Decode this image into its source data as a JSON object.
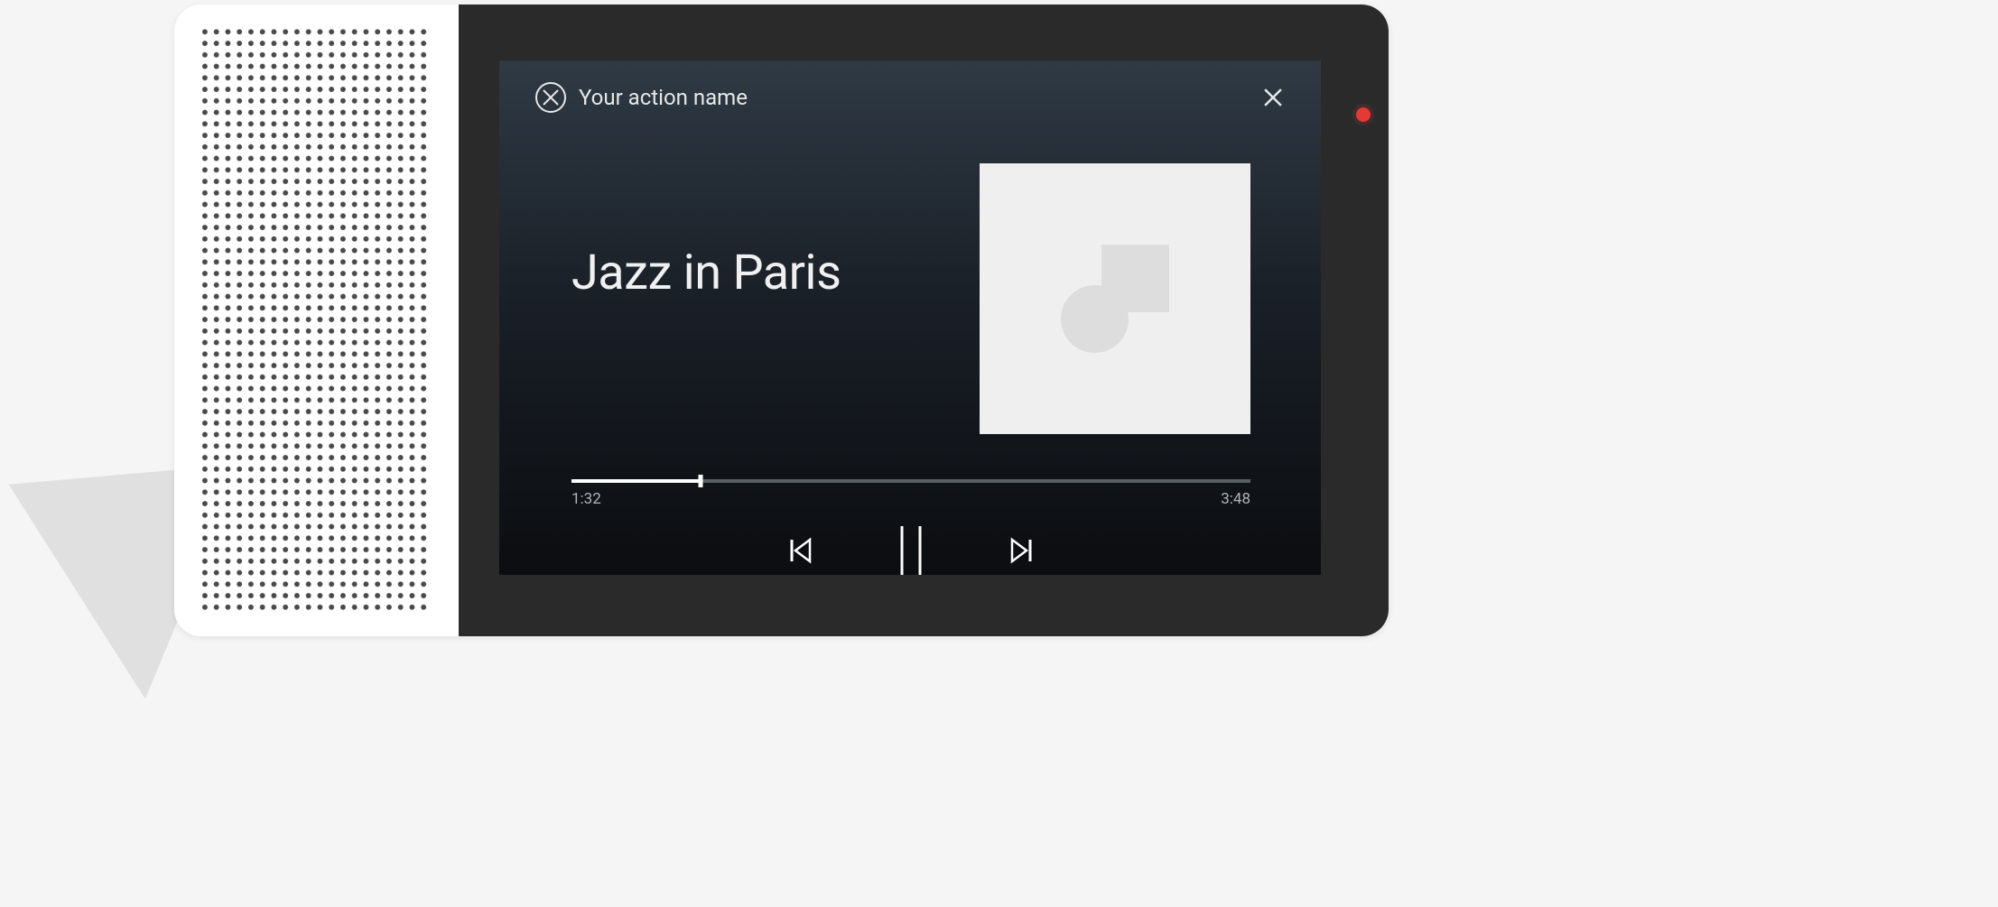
{
  "header": {
    "action_name": "Your action name"
  },
  "player": {
    "track_title": "Jazz in Paris",
    "elapsed": "1:32",
    "duration": "3:48",
    "progress_percent": 19
  },
  "icons": {
    "close": "close-icon",
    "previous": "skip-previous-icon",
    "pause": "pause-icon",
    "next": "skip-next-icon",
    "app": "app-logo-icon",
    "album_placeholder": "image-placeholder-icon"
  }
}
